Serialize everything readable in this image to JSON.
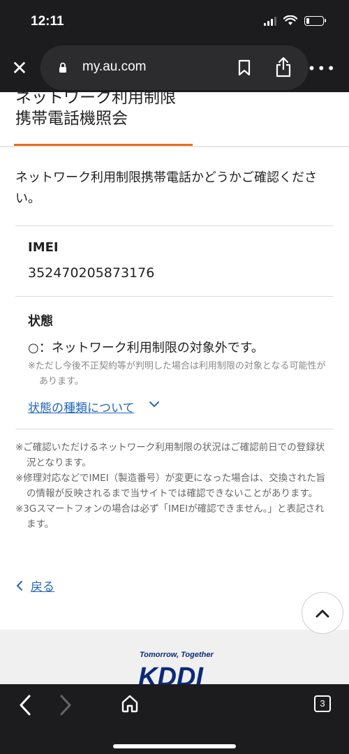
{
  "status_bar": {
    "time": "12:11",
    "battery_level": 0.2
  },
  "browser": {
    "url": "my.au.com",
    "tab_count": "3"
  },
  "page": {
    "title_cut": "ネットワーク利用制限",
    "title": "携帯電話機照会",
    "intro": "ネットワーク利用制限携帯電話かどうかご確認ください。",
    "imei_label": "IMEI",
    "imei_value": "352470205873176",
    "status_label": "状態",
    "status_text": "○：ネットワーク利用制限の対象外です。",
    "status_note": "※ただし今後不正契約等が判明した場合は利用制限の対象となる可能性があります。",
    "types_link": "状態の種類について",
    "notes": [
      "※ご確認いただけるネットワーク利用制限の状況はご確認前日での登録状況となります。",
      "※修理対応などでIMEI（製造番号）が変更になった場合は、交換された旨の情報が反映されるまで当サイトでは確認できないことがあります。",
      "※3Gスマートフォンの場合は必ず「IMEIが確認できません。」と表記されます。"
    ],
    "back_link": "戻る"
  },
  "footer": {
    "tagline": "Tomorrow, Together",
    "logo_text": "KDDI"
  },
  "colors": {
    "accent": "#e86f1a",
    "link": "#2266bb",
    "brand": "#0b2a78"
  }
}
